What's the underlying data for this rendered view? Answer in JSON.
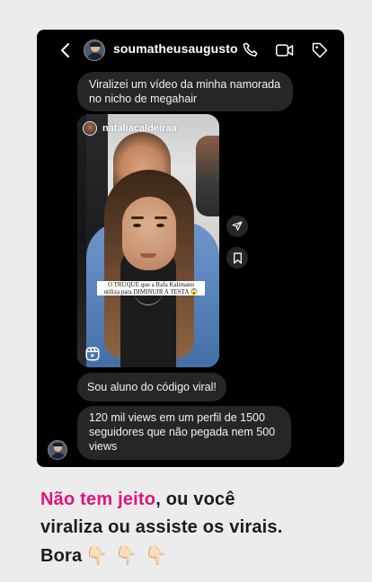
{
  "conversation": {
    "username": "soumatheusaugusto"
  },
  "header_icons": [
    "back-chevron-icon",
    "phone-icon",
    "video-camera-icon",
    "tag-icon"
  ],
  "messages": {
    "first": {
      "line1": "Viralizei um vídeo da minha namorada",
      "line2": "no nicho de megahair"
    },
    "shared_reel": {
      "author": "nataliacaldeiraa",
      "caption_line1": "O TRUQUE que a Rafa Kalimann",
      "caption_line2": "utiliza para DIMINUIR A TESTA 😱"
    },
    "second": "Sou aluno do código viral!",
    "third": {
      "line1": "120 mil views em um perfil de 1500",
      "line2": "seguidores que não pegada nem 500",
      "line3": "views"
    }
  },
  "overlay_text": {
    "pink_part": "Não tem jeito",
    "rest_line1": ", ou você",
    "line2": "viraliza ou assiste os virais.",
    "line3": "Bora",
    "emojis": "👇🏻👇🏻👇🏻"
  },
  "colors": {
    "accent_pink": "#e0157b",
    "bubble": "#262626",
    "background": "#ececec"
  }
}
